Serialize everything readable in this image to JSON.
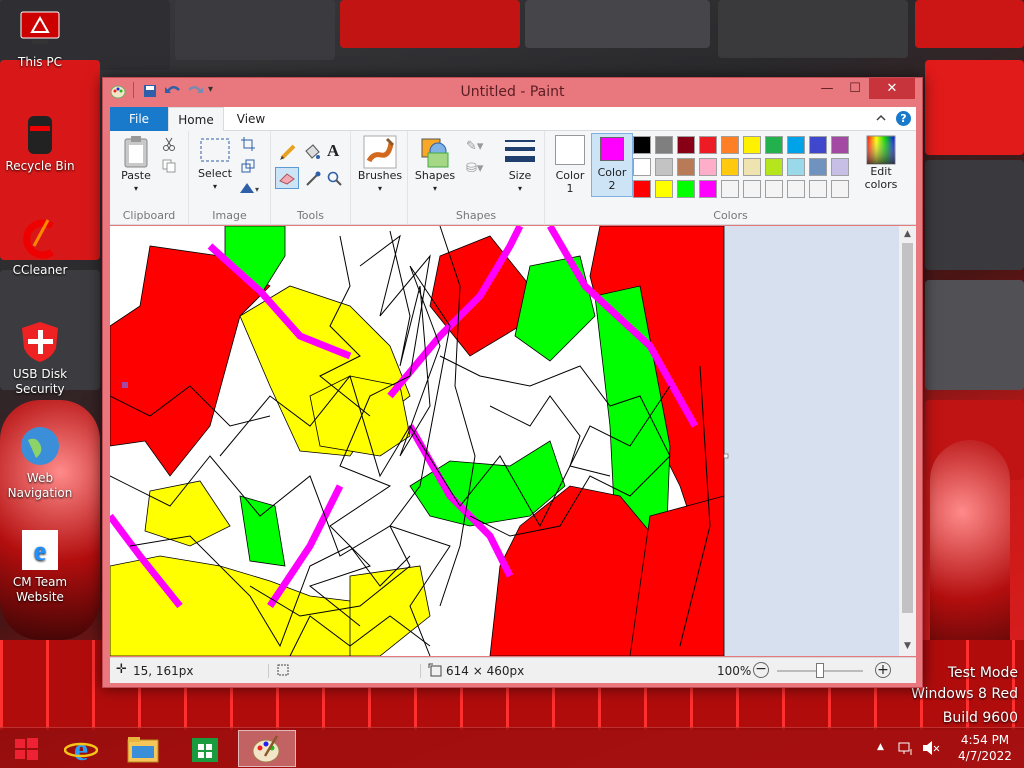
{
  "desktop": {
    "icons": [
      {
        "label": "This PC",
        "icon": "this-pc-icon"
      },
      {
        "label": "Recycle Bin",
        "icon": "recycle-bin-icon"
      },
      {
        "label": "CCleaner",
        "icon": "ccleaner-icon"
      },
      {
        "label": "USB Disk Security",
        "icon": "usb-disk-security-icon"
      },
      {
        "label": "Web Navigation",
        "icon": "web-navigation-icon"
      },
      {
        "label": "CM Team Website",
        "icon": "internet-explorer-icon"
      }
    ],
    "watermark": {
      "line1": "Test Mode",
      "line2": "Windows 8 Red",
      "line3": "Build 9600"
    }
  },
  "window": {
    "title": "Untitled - Paint",
    "quick_access": [
      "save-icon",
      "undo-icon",
      "redo-icon",
      "customize-icon"
    ],
    "tabs": {
      "file": "File",
      "home": "Home",
      "view": "View"
    },
    "ribbon": {
      "clipboard": {
        "label": "Clipboard",
        "paste": "Paste"
      },
      "image": {
        "label": "Image",
        "select": "Select"
      },
      "tools": {
        "label": "Tools"
      },
      "brushes": {
        "label": "Brushes"
      },
      "shapes": {
        "label": "Shapes",
        "shapes_btn": "Shapes"
      },
      "size": {
        "label": "Size"
      },
      "colors": {
        "label": "Colors",
        "color1": {
          "l1": "Color",
          "l2": "1",
          "value": "#ffffff"
        },
        "color2": {
          "l1": "Color",
          "l2": "2",
          "value": "#ff00ff"
        },
        "edit_l1": "Edit",
        "edit_l2": "colors",
        "palette": [
          [
            "#000000",
            "#7f7f7f",
            "#880015",
            "#ed1c24",
            "#ff7f27",
            "#fff200",
            "#22b14c",
            "#00a2e8",
            "#3f48cc",
            "#a349a4"
          ],
          [
            "#ffffff",
            "#c3c3c3",
            "#b97a57",
            "#ffaec9",
            "#ffc90e",
            "#efe4b0",
            "#b5e61d",
            "#99d9ea",
            "#7092be",
            "#c8bfe7"
          ],
          [
            "#ff0000",
            "#ffff00",
            "#00ff00",
            "#ff00ff",
            "#f4f4f4",
            "#f4f4f4",
            "#f4f4f4",
            "#f4f4f4",
            "#f4f4f4",
            "#f4f4f4"
          ]
        ]
      }
    },
    "status": {
      "cursor": "15, 161px",
      "size": "614 × 460px",
      "zoom": "100%"
    }
  },
  "taskbar": {
    "time": "4:54 PM",
    "date": "4/7/2022",
    "apps": [
      "internet-explorer-icon",
      "file-explorer-icon",
      "store-icon",
      "paint-icon"
    ]
  }
}
